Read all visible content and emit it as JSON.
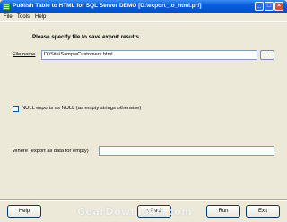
{
  "window": {
    "title": "Publish Table to HTML for SQL Server DEMO [D:\\export_to_html.prf]",
    "minimize_glyph": "_",
    "maximize_glyph": "□",
    "close_glyph": "×"
  },
  "menu": {
    "file": "File",
    "tools": "Tools",
    "help": "Help"
  },
  "main": {
    "heading": "Please specify file to save export results",
    "file_name_label": "File name",
    "file_name_value": "D:\\Site\\SampleCustomers.html",
    "browse_label": "...",
    "null_checkbox_label": "NULL exports as NULL (as empty strings otherwise)",
    "null_checkbox_checked": false,
    "where_label": "Where (export all data for empty)",
    "where_value": ""
  },
  "footer": {
    "help_button": "Help",
    "back_button": "< Back",
    "run_button": "Run",
    "exit_button": "Exit",
    "watermark": "GearDownload.com"
  }
}
